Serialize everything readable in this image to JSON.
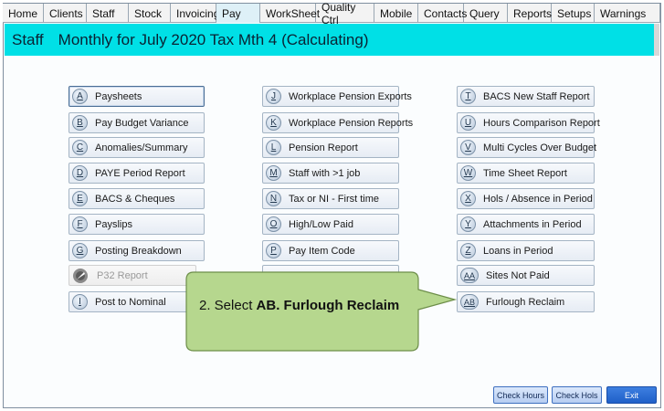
{
  "menu": [
    {
      "label": "Home",
      "w": 45,
      "active": false
    },
    {
      "label": "Clients",
      "w": 47,
      "active": false
    },
    {
      "label": "Staff",
      "w": 46,
      "active": false
    },
    {
      "label": "Stock",
      "w": 46,
      "active": false
    },
    {
      "label": "Invoicing",
      "w": 50,
      "active": false
    },
    {
      "label": "Pay",
      "w": 48,
      "active": true
    },
    {
      "label": "WorkSheet",
      "w": 61,
      "active": false
    },
    {
      "label": "Quality Ctrl",
      "w": 64,
      "active": false
    },
    {
      "label": "Mobile",
      "w": 48,
      "active": false
    },
    {
      "label": "Contacts",
      "w": 50,
      "active": false
    },
    {
      "label": "Query",
      "w": 48,
      "active": false
    },
    {
      "label": "Reports",
      "w": 48,
      "active": false
    },
    {
      "label": "Setups",
      "w": 47,
      "active": false
    },
    {
      "label": "Warnings",
      "w": 72,
      "active": false
    }
  ],
  "title": {
    "section": "Staff",
    "period": "Monthly for July 2020 Tax Mth  4  (Calculating)"
  },
  "columns": [
    {
      "buttons": [
        {
          "key": "A",
          "label": "Paysheets"
        },
        {
          "key": "B",
          "label": "Pay Budget Variance"
        },
        {
          "key": "C",
          "label": "Anomalies/Summary"
        },
        {
          "key": "D",
          "label": "PAYE Period Report"
        },
        {
          "key": "E",
          "label": "BACS & Cheques"
        },
        {
          "key": "F",
          "label": "Payslips"
        },
        {
          "key": "G",
          "label": "Posting Breakdown"
        },
        {
          "key": "",
          "label": "P32 Report"
        },
        {
          "key": "I",
          "label": "Post to Nominal"
        }
      ]
    },
    {
      "buttons": [
        {
          "key": "J",
          "label": "Workplace Pension Exports"
        },
        {
          "key": "K",
          "label": "Workplace Pension Reports"
        },
        {
          "key": "L",
          "label": "Pension Report"
        },
        {
          "key": "M",
          "label": "Staff with >1 job"
        },
        {
          "key": "N",
          "label": "Tax or NI - First time"
        },
        {
          "key": "O",
          "label": "High/Low Paid"
        },
        {
          "key": "P",
          "label": "Pay Item Code"
        },
        {
          "key": "",
          "label": ""
        }
      ]
    },
    {
      "buttons": [
        {
          "key": "T",
          "label": "BACS New Staff Report"
        },
        {
          "key": "U",
          "label": "Hours Comparison Report"
        },
        {
          "key": "V",
          "label": "Multi Cycles Over Budget"
        },
        {
          "key": "W",
          "label": "Time Sheet Report"
        },
        {
          "key": "X",
          "label": "Hols / Absence in Period"
        },
        {
          "key": "Y",
          "label": "Attachments in Period"
        },
        {
          "key": "Z",
          "label": "Loans in Period"
        },
        {
          "key": "AA",
          "label": "Sites Not Paid"
        },
        {
          "key": "AB",
          "label": "Furlough Reclaim"
        }
      ]
    }
  ],
  "callout": {
    "prefix": "2. Select ",
    "emphasis": "AB. Furlough Reclaim"
  },
  "footer": {
    "check_hours": "Check Hours",
    "check_hols": "Check Hols",
    "exit": "Exit"
  },
  "colors": {
    "title_bar": "#00e0e6",
    "callout_fill": "#b6d78e",
    "callout_border": "#6d8e49",
    "exit_button": "#1f5fc8"
  }
}
